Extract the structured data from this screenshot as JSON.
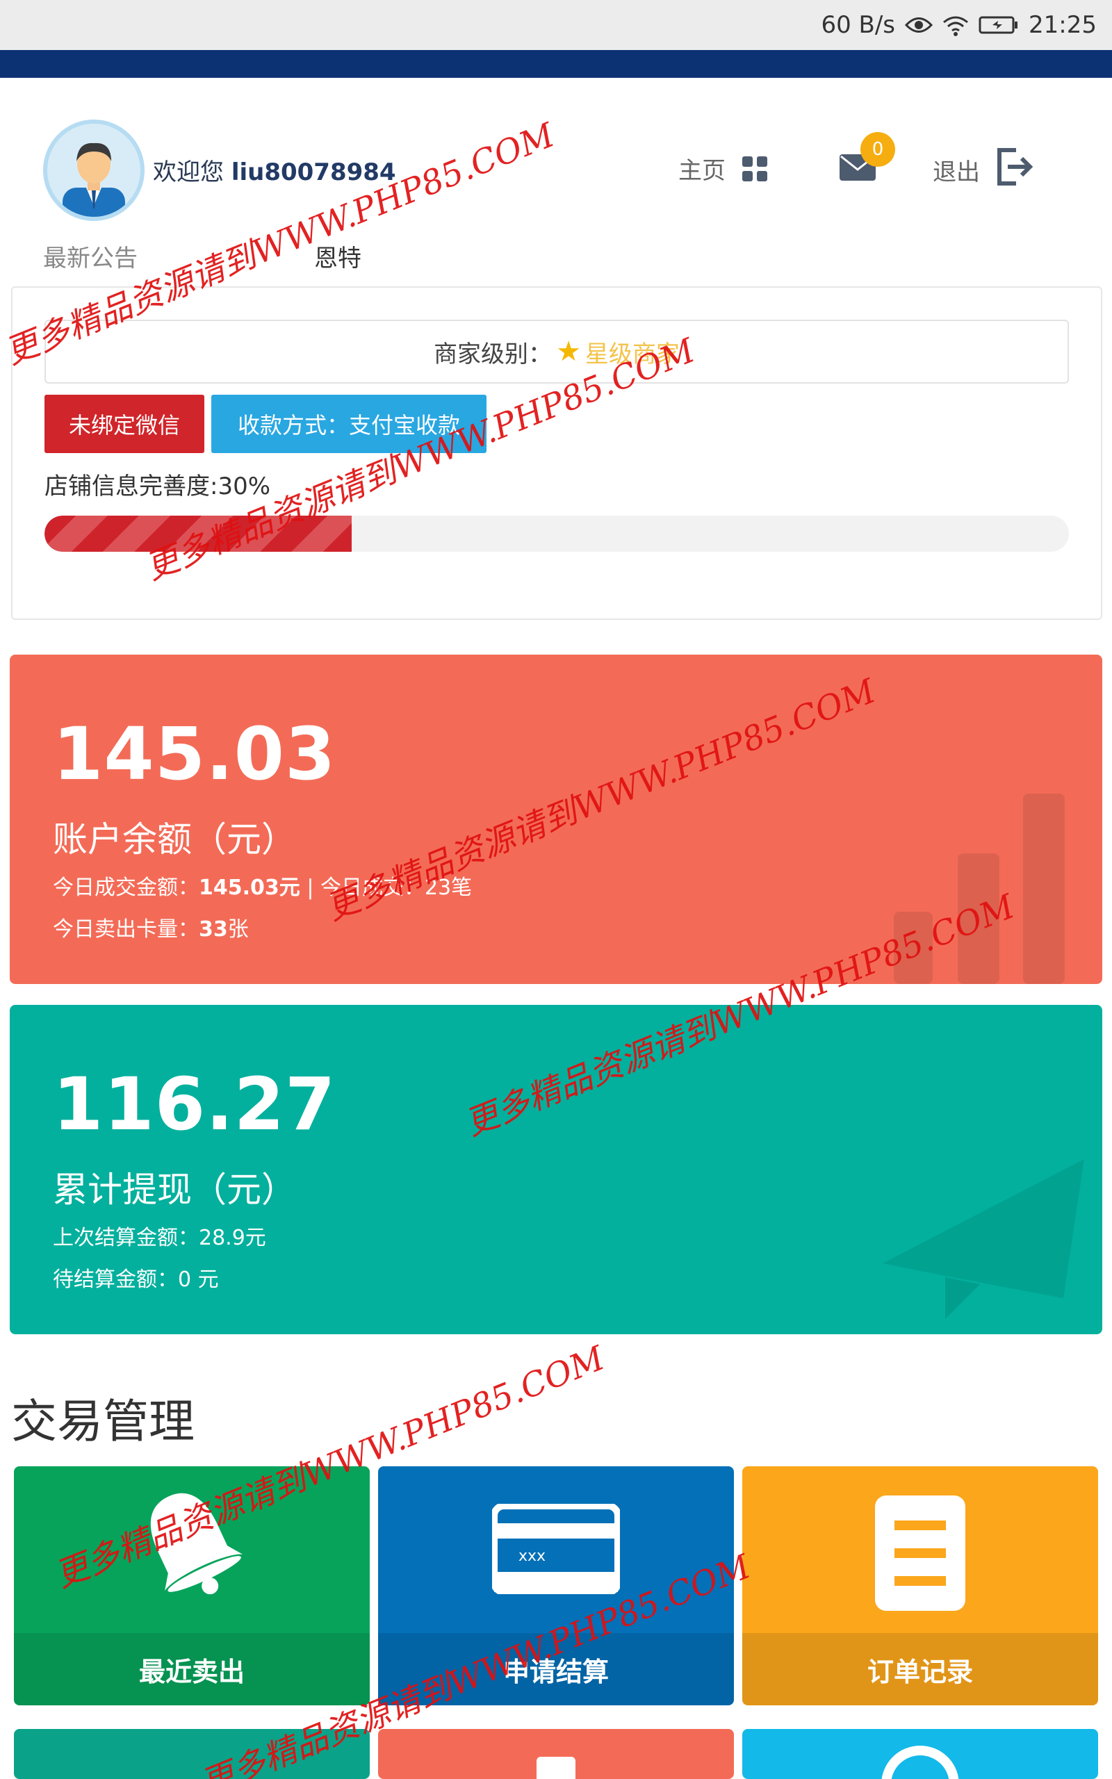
{
  "status_bar": {
    "speed": "60 B/s",
    "time": "21:25"
  },
  "header": {
    "welcome_prefix": "欢迎您",
    "username": "liu80078984",
    "home_label": "主页",
    "mail_badge": "0",
    "logout_label": "退出"
  },
  "notice": {
    "label": "最新公告",
    "text": "恩特"
  },
  "shop": {
    "level_label": "商家级别：",
    "level_value": "星级商家",
    "wechat_button": "未绑定微信",
    "payment_button": "收款方式：支付宝收款",
    "completeness_text": "店铺信息完善度:30%",
    "completeness_percent": 30
  },
  "balance_card": {
    "value": "145.03",
    "label": "账户余额（元）",
    "line1_prefix": "今日成交金额：",
    "line1_amount": "145.03元",
    "line1_sep": " | 今日成交：23笔",
    "line2_prefix": "今日卖出卡量：",
    "line2_count": "33",
    "line2_suffix": "张"
  },
  "withdraw_card": {
    "value": "116.27",
    "label": "累计提现（元）",
    "line1": "上次结算金额：28.9元",
    "line2": "待结算金额：0 元"
  },
  "section": {
    "title": "交易管理"
  },
  "tiles": [
    {
      "label": "最近卖出",
      "icon": "bell-icon",
      "color": "#07a35b"
    },
    {
      "label": "申请结算",
      "icon": "card-icon",
      "color": "#0470b8"
    },
    {
      "label": "订单记录",
      "icon": "document-icon",
      "color": "#fba61b"
    }
  ],
  "watermark": "更多精品资源请到WWW.PHP85.COM"
}
